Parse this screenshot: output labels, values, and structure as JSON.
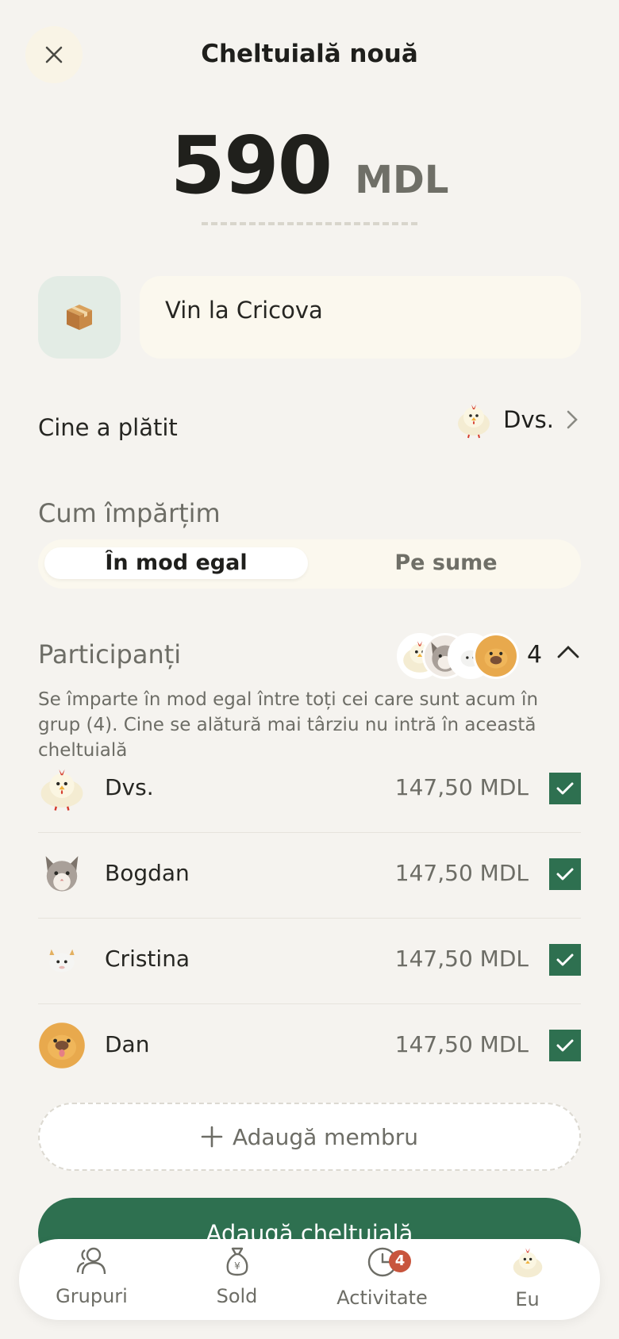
{
  "header": {
    "title": "Cheltuială nouă",
    "close_icon": "close-icon"
  },
  "amount": {
    "value": "590",
    "currency": "MDL"
  },
  "expense": {
    "category_icon": "package-icon",
    "description": "Vin la Cricova"
  },
  "paid_by": {
    "label": "Cine a plătit",
    "payer": "Dvs."
  },
  "split": {
    "label": "Cum împărțim",
    "options": [
      "În mod egal",
      "Pe sume"
    ],
    "selected": "În mod egal"
  },
  "participants": {
    "label": "Participanți",
    "count": "4",
    "note": "Se împarte în mod egal între toți cei care sunt acum în grup (4). Cine se alătură mai târziu nu intră în această cheltuială",
    "members": [
      {
        "name": "Dvs.",
        "share": "147,50 MDL",
        "avatar": "chicken-avatar",
        "checked": true
      },
      {
        "name": "Bogdan",
        "share": "147,50 MDL",
        "avatar": "cat-avatar",
        "checked": true
      },
      {
        "name": "Cristina",
        "share": "147,50 MDL",
        "avatar": "goat-avatar",
        "checked": true
      },
      {
        "name": "Dan",
        "share": "147,50 MDL",
        "avatar": "dog-avatar",
        "checked": true
      }
    ],
    "add_label": "Adaugă membru"
  },
  "primary_action": "Adaugă cheltuială",
  "tabbar": {
    "items": [
      {
        "label": "Grupuri",
        "icon": "people-icon"
      },
      {
        "label": "Sold",
        "icon": "money-bag-icon"
      },
      {
        "label": "Activitate",
        "icon": "clock-icon",
        "badge": "4"
      },
      {
        "label": "Eu",
        "icon": "chicken-avatar"
      }
    ]
  },
  "colors": {
    "accent": "#2e7050",
    "badge": "#c8553d",
    "background": "#f5f3ef"
  }
}
